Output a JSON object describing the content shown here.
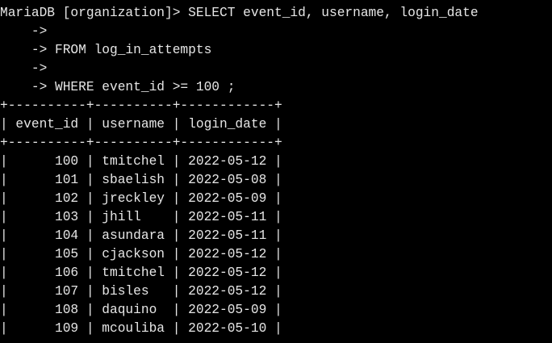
{
  "terminal": {
    "lines": [
      "MariaDB [organization]> SELECT event_id, username, login_date",
      "    ->",
      "    -> FROM log_in_attempts",
      "    ->",
      "    -> WHERE event_id >= 100 ;",
      "+----------+----------+------------+",
      "| event_id | username | login_date |",
      "+----------+----------+------------+",
      "|      100 | tmitchel | 2022-05-12 |",
      "|      101 | sbaelish | 2022-05-08 |",
      "|      102 | jreckley | 2022-05-09 |",
      "|      103 | jhill    | 2022-05-11 |",
      "|      104 | asundara | 2022-05-11 |",
      "|      105 | cjackson | 2022-05-12 |",
      "|      106 | tmitchel | 2022-05-12 |",
      "|      107 | bisles   | 2022-05-12 |",
      "|      108 | daquino  | 2022-05-09 |",
      "|      109 | mcouliba | 2022-05-10 |"
    ]
  },
  "colors": {
    "background": "#000000",
    "foreground": "#e6e6e6"
  }
}
